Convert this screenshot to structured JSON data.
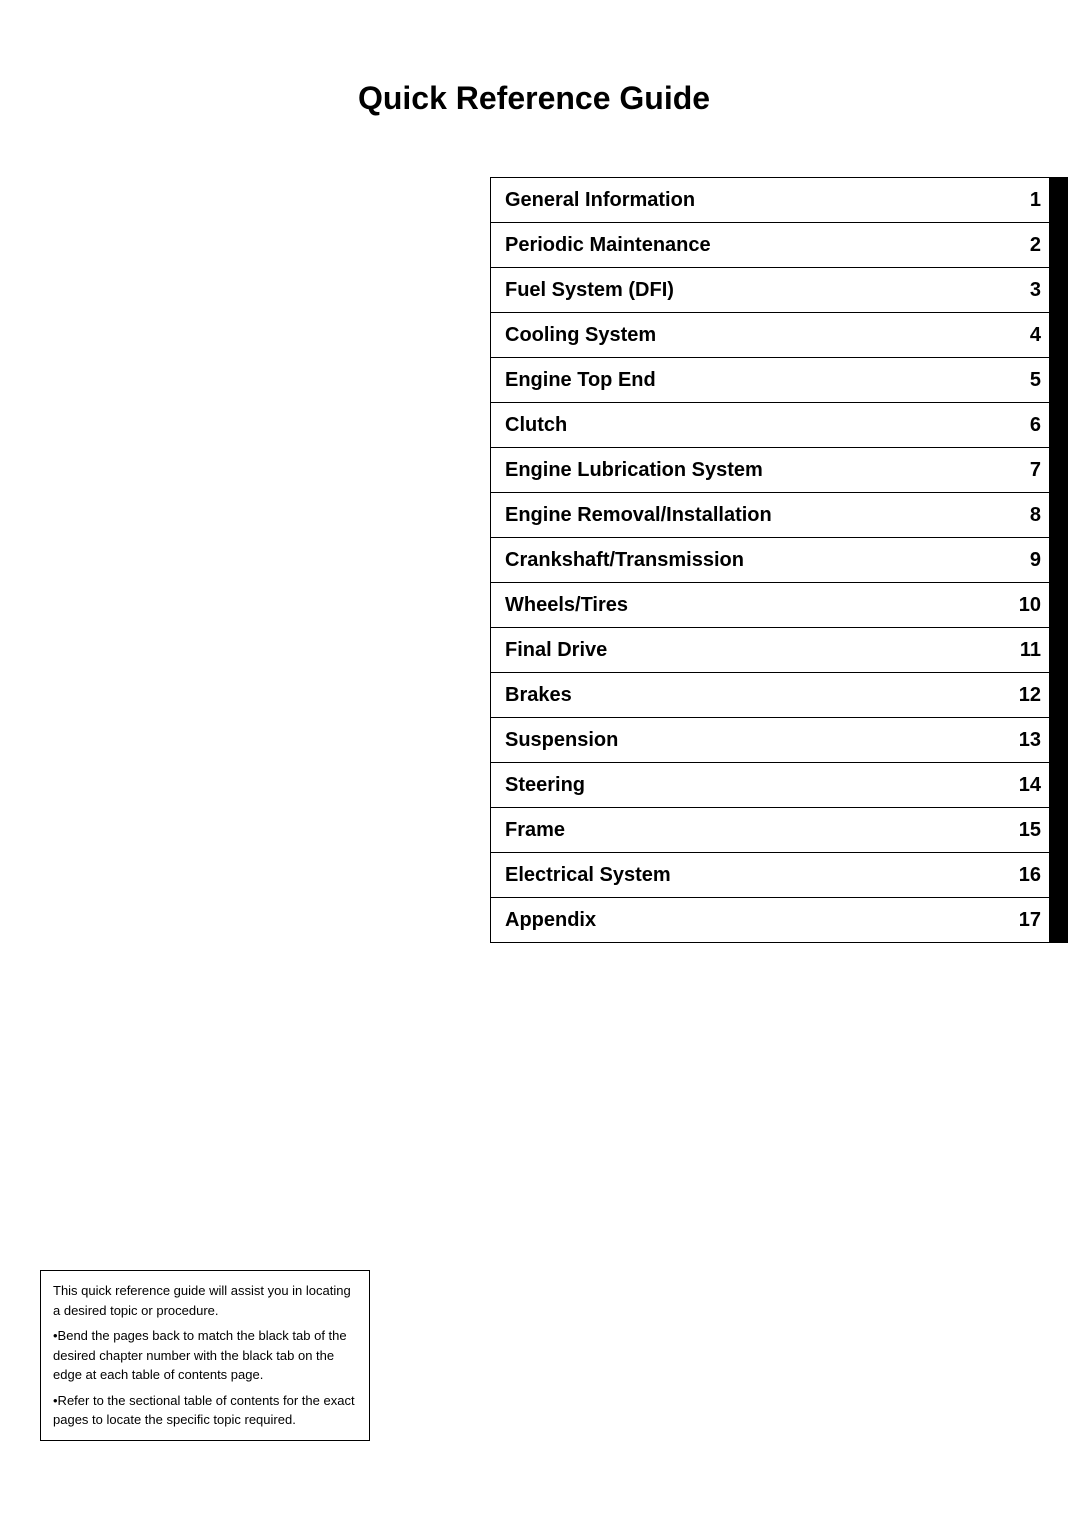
{
  "page": {
    "title": "Quick Reference Guide"
  },
  "toc": {
    "items": [
      {
        "label": "General Information",
        "number": "1"
      },
      {
        "label": "Periodic Maintenance",
        "number": "2"
      },
      {
        "label": "Fuel System (DFI)",
        "number": "3"
      },
      {
        "label": "Cooling System",
        "number": "4"
      },
      {
        "label": "Engine Top End",
        "number": "5"
      },
      {
        "label": "Clutch",
        "number": "6"
      },
      {
        "label": "Engine Lubrication System",
        "number": "7"
      },
      {
        "label": "Engine Removal/Installation",
        "number": "8"
      },
      {
        "label": "Crankshaft/Transmission",
        "number": "9"
      },
      {
        "label": "Wheels/Tires",
        "number": "10"
      },
      {
        "label": "Final Drive",
        "number": "11"
      },
      {
        "label": "Brakes",
        "number": "12"
      },
      {
        "label": "Suspension",
        "number": "13"
      },
      {
        "label": "Steering",
        "number": "14"
      },
      {
        "label": "Frame",
        "number": "15"
      },
      {
        "label": "Electrical System",
        "number": "16"
      },
      {
        "label": "Appendix",
        "number": "17"
      }
    ]
  },
  "footnote": {
    "line1": "This quick reference guide will assist you in locating a desired topic or procedure.",
    "line2": "•Bend the pages back to match the black tab of the desired chapter number with the black tab on the edge at each table of contents page.",
    "line3": "•Refer to the sectional table of contents for the exact pages to locate the specific topic required."
  }
}
